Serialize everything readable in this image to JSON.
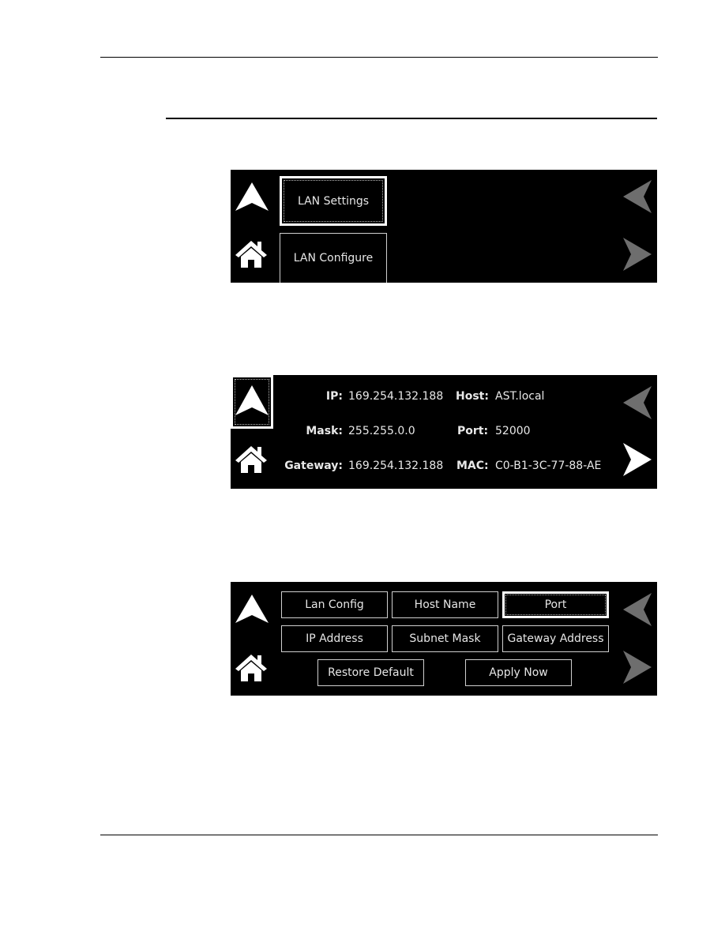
{
  "document": {
    "rules": [
      "header-rule",
      "section-rule",
      "footer-rule"
    ]
  },
  "panel_lan_menu": {
    "icons": {
      "up": "up-arrow-icon",
      "home": "home-icon",
      "prev": "left-arrow-icon",
      "next": "right-arrow-icon"
    },
    "buttons": [
      {
        "label": "LAN Settings",
        "selected": true
      },
      {
        "label": "LAN Configure",
        "selected": false
      }
    ]
  },
  "panel_lan_settings": {
    "icons": {
      "up": "up-arrow-icon",
      "home": "home-icon",
      "prev": "left-arrow-icon",
      "next": "right-arrow-icon"
    },
    "fields": {
      "ip": {
        "label": "IP:",
        "value": "169.254.132.188"
      },
      "host": {
        "label": "Host:",
        "value": "AST.local"
      },
      "mask": {
        "label": "Mask:",
        "value": "255.255.0.0"
      },
      "port": {
        "label": "Port:",
        "value": "52000"
      },
      "gateway": {
        "label": "Gateway:",
        "value": "169.254.132.188"
      },
      "mac": {
        "label": "MAC:",
        "value": "C0-B1-3C-77-88-AE"
      }
    }
  },
  "panel_lan_configure": {
    "icons": {
      "up": "up-arrow-icon",
      "home": "home-icon",
      "prev": "left-arrow-icon",
      "next": "right-arrow-icon"
    },
    "buttons": [
      {
        "label": "Lan Config",
        "selected": false
      },
      {
        "label": "Host Name",
        "selected": false
      },
      {
        "label": "Port",
        "selected": true
      },
      {
        "label": "IP Address",
        "selected": false
      },
      {
        "label": "Subnet Mask",
        "selected": false
      },
      {
        "label": "Gateway Address",
        "selected": false
      },
      {
        "label": "Restore Default",
        "selected": false
      },
      {
        "label": "Apply Now",
        "selected": false
      }
    ]
  },
  "colors": {
    "panel_bg": "#000000",
    "icon_active": "#ffffff",
    "icon_inactive": "#6e6e6e",
    "button_border": "#cfcfcf"
  }
}
